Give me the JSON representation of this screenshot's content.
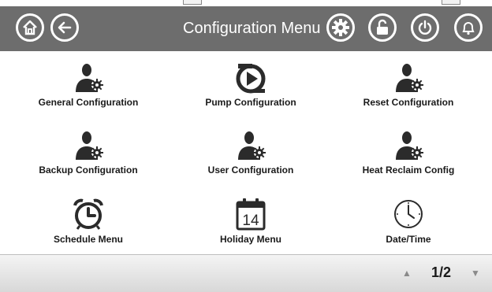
{
  "header": {
    "title": "Configuration Menu",
    "background_color": "#6d6d6d",
    "icons": [
      "home-icon",
      "back-icon",
      "gear-icon",
      "unlock-icon",
      "power-icon",
      "bell-icon"
    ]
  },
  "tiles": [
    {
      "label": "General Configuration",
      "icon": "user-gear-icon"
    },
    {
      "label": "Pump Configuration",
      "icon": "pump-icon"
    },
    {
      "label": "Reset Configuration",
      "icon": "user-gear-icon"
    },
    {
      "label": "Backup Configuration",
      "icon": "user-gear-icon"
    },
    {
      "label": "User Configuration",
      "icon": "user-gear-icon"
    },
    {
      "label": "Heat Reclaim Config",
      "icon": "user-gear-icon"
    },
    {
      "label": "Schedule Menu",
      "icon": "alarm-clock-icon"
    },
    {
      "label": "Holiday Menu",
      "icon": "calendar-icon",
      "calendar_day": "14"
    },
    {
      "label": "Date/Time",
      "icon": "clock-icon"
    }
  ],
  "footer": {
    "page_label": "1/2",
    "up_icon": "▲",
    "down_icon": "▼"
  }
}
